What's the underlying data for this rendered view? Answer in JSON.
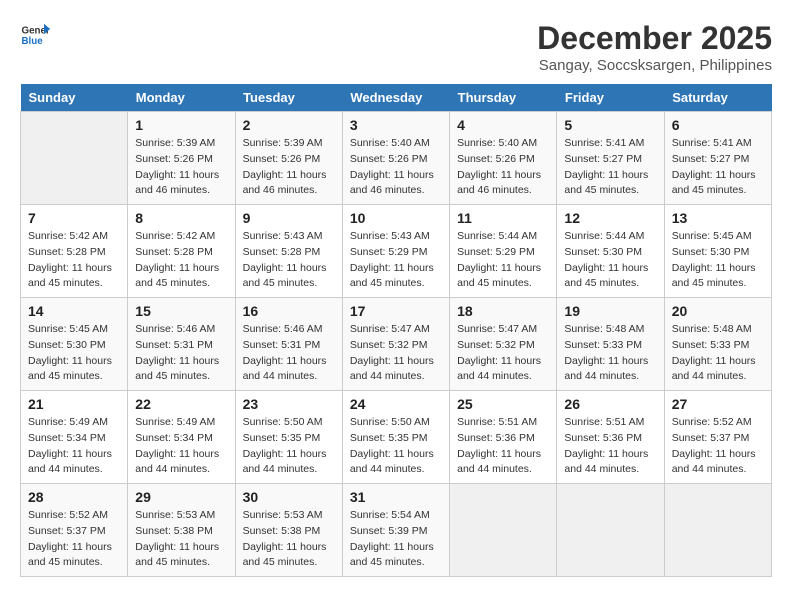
{
  "logo": {
    "line1": "General",
    "line2": "Blue"
  },
  "title": "December 2025",
  "subtitle": "Sangay, Soccsksargen, Philippines",
  "days_of_week": [
    "Sunday",
    "Monday",
    "Tuesday",
    "Wednesday",
    "Thursday",
    "Friday",
    "Saturday"
  ],
  "weeks": [
    [
      {
        "day": "",
        "info": ""
      },
      {
        "day": "1",
        "info": "Sunrise: 5:39 AM\nSunset: 5:26 PM\nDaylight: 11 hours\nand 46 minutes."
      },
      {
        "day": "2",
        "info": "Sunrise: 5:39 AM\nSunset: 5:26 PM\nDaylight: 11 hours\nand 46 minutes."
      },
      {
        "day": "3",
        "info": "Sunrise: 5:40 AM\nSunset: 5:26 PM\nDaylight: 11 hours\nand 46 minutes."
      },
      {
        "day": "4",
        "info": "Sunrise: 5:40 AM\nSunset: 5:26 PM\nDaylight: 11 hours\nand 46 minutes."
      },
      {
        "day": "5",
        "info": "Sunrise: 5:41 AM\nSunset: 5:27 PM\nDaylight: 11 hours\nand 45 minutes."
      },
      {
        "day": "6",
        "info": "Sunrise: 5:41 AM\nSunset: 5:27 PM\nDaylight: 11 hours\nand 45 minutes."
      }
    ],
    [
      {
        "day": "7",
        "info": "Sunrise: 5:42 AM\nSunset: 5:28 PM\nDaylight: 11 hours\nand 45 minutes."
      },
      {
        "day": "8",
        "info": "Sunrise: 5:42 AM\nSunset: 5:28 PM\nDaylight: 11 hours\nand 45 minutes."
      },
      {
        "day": "9",
        "info": "Sunrise: 5:43 AM\nSunset: 5:28 PM\nDaylight: 11 hours\nand 45 minutes."
      },
      {
        "day": "10",
        "info": "Sunrise: 5:43 AM\nSunset: 5:29 PM\nDaylight: 11 hours\nand 45 minutes."
      },
      {
        "day": "11",
        "info": "Sunrise: 5:44 AM\nSunset: 5:29 PM\nDaylight: 11 hours\nand 45 minutes."
      },
      {
        "day": "12",
        "info": "Sunrise: 5:44 AM\nSunset: 5:30 PM\nDaylight: 11 hours\nand 45 minutes."
      },
      {
        "day": "13",
        "info": "Sunrise: 5:45 AM\nSunset: 5:30 PM\nDaylight: 11 hours\nand 45 minutes."
      }
    ],
    [
      {
        "day": "14",
        "info": "Sunrise: 5:45 AM\nSunset: 5:30 PM\nDaylight: 11 hours\nand 45 minutes."
      },
      {
        "day": "15",
        "info": "Sunrise: 5:46 AM\nSunset: 5:31 PM\nDaylight: 11 hours\nand 45 minutes."
      },
      {
        "day": "16",
        "info": "Sunrise: 5:46 AM\nSunset: 5:31 PM\nDaylight: 11 hours\nand 44 minutes."
      },
      {
        "day": "17",
        "info": "Sunrise: 5:47 AM\nSunset: 5:32 PM\nDaylight: 11 hours\nand 44 minutes."
      },
      {
        "day": "18",
        "info": "Sunrise: 5:47 AM\nSunset: 5:32 PM\nDaylight: 11 hours\nand 44 minutes."
      },
      {
        "day": "19",
        "info": "Sunrise: 5:48 AM\nSunset: 5:33 PM\nDaylight: 11 hours\nand 44 minutes."
      },
      {
        "day": "20",
        "info": "Sunrise: 5:48 AM\nSunset: 5:33 PM\nDaylight: 11 hours\nand 44 minutes."
      }
    ],
    [
      {
        "day": "21",
        "info": "Sunrise: 5:49 AM\nSunset: 5:34 PM\nDaylight: 11 hours\nand 44 minutes."
      },
      {
        "day": "22",
        "info": "Sunrise: 5:49 AM\nSunset: 5:34 PM\nDaylight: 11 hours\nand 44 minutes."
      },
      {
        "day": "23",
        "info": "Sunrise: 5:50 AM\nSunset: 5:35 PM\nDaylight: 11 hours\nand 44 minutes."
      },
      {
        "day": "24",
        "info": "Sunrise: 5:50 AM\nSunset: 5:35 PM\nDaylight: 11 hours\nand 44 minutes."
      },
      {
        "day": "25",
        "info": "Sunrise: 5:51 AM\nSunset: 5:36 PM\nDaylight: 11 hours\nand 44 minutes."
      },
      {
        "day": "26",
        "info": "Sunrise: 5:51 AM\nSunset: 5:36 PM\nDaylight: 11 hours\nand 44 minutes."
      },
      {
        "day": "27",
        "info": "Sunrise: 5:52 AM\nSunset: 5:37 PM\nDaylight: 11 hours\nand 44 minutes."
      }
    ],
    [
      {
        "day": "28",
        "info": "Sunrise: 5:52 AM\nSunset: 5:37 PM\nDaylight: 11 hours\nand 45 minutes."
      },
      {
        "day": "29",
        "info": "Sunrise: 5:53 AM\nSunset: 5:38 PM\nDaylight: 11 hours\nand 45 minutes."
      },
      {
        "day": "30",
        "info": "Sunrise: 5:53 AM\nSunset: 5:38 PM\nDaylight: 11 hours\nand 45 minutes."
      },
      {
        "day": "31",
        "info": "Sunrise: 5:54 AM\nSunset: 5:39 PM\nDaylight: 11 hours\nand 45 minutes."
      },
      {
        "day": "",
        "info": ""
      },
      {
        "day": "",
        "info": ""
      },
      {
        "day": "",
        "info": ""
      }
    ]
  ]
}
